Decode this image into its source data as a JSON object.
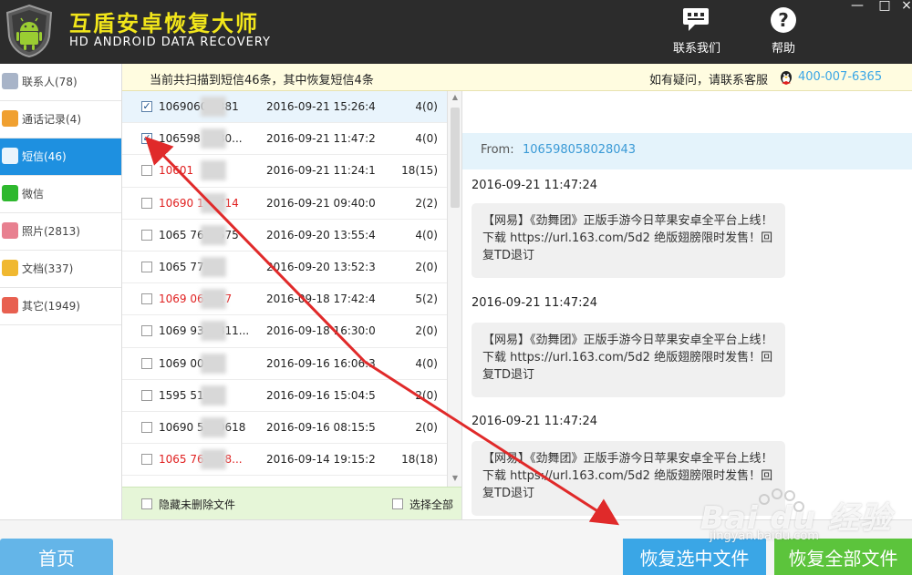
{
  "header": {
    "title": "互盾安卓恢复大师",
    "subtitle": "HD ANDROID DATA RECOVERY",
    "contact_label": "联系我们",
    "help_label": "帮助",
    "contact_icon": "chat-icon",
    "help_icon": "help-icon"
  },
  "window_controls": {
    "minimize": "—",
    "maximize": "□",
    "close": "×"
  },
  "sidebar": {
    "items": [
      {
        "label": "联系人(78)",
        "icon": "contacts-icon",
        "color": "#a8b4c8"
      },
      {
        "label": "通话记录(4)",
        "icon": "phone-icon",
        "color": "#f0a030"
      },
      {
        "label": "短信(46)",
        "icon": "message-icon",
        "color": "#ffffff"
      },
      {
        "label": "微信",
        "icon": "wechat-icon",
        "color": "#2eb82e"
      },
      {
        "label": "照片(2813)",
        "icon": "photo-icon",
        "color": "#e88090"
      },
      {
        "label": "文档(337)",
        "icon": "document-icon",
        "color": "#f0b830"
      },
      {
        "label": "其它(1949)",
        "icon": "other-icon",
        "color": "#e86050"
      }
    ],
    "active_index": 2
  },
  "infobar": {
    "scan_text": "当前共扫描到短信46条，其中恢复短信4条",
    "contact_text": "如有疑问，请联系客服",
    "phone": "400-007-6365"
  },
  "message_list": {
    "rows": [
      {
        "number": "1069060    5381",
        "date": "2016-09-21 15:26:4",
        "count": "4(0)",
        "checked": true,
        "red": false
      },
      {
        "number": "106598     0280...",
        "date": "2016-09-21 11:47:2",
        "count": "4(0)",
        "checked": true,
        "red": false
      },
      {
        "number": "10601",
        "date": "2016-09-21 11:24:1",
        "count": "18(15)",
        "checked": false,
        "red": true
      },
      {
        "number": "10690     135714",
        "date": "2016-09-21 09:40:0",
        "count": "2(2)",
        "checked": false,
        "red": true
      },
      {
        "number": "1065     7696575",
        "date": "2016-09-20 13:55:4",
        "count": "4(0)",
        "checked": false,
        "red": false
      },
      {
        "number": "1065     771",
        "date": "2016-09-20 13:52:3",
        "count": "2(0)",
        "checked": false,
        "red": false
      },
      {
        "number": "1069     060717",
        "date": "2016-09-18 17:42:4",
        "count": "5(2)",
        "checked": false,
        "red": true
      },
      {
        "number": "1069     9348811...",
        "date": "2016-09-18 16:30:0",
        "count": "2(0)",
        "checked": false,
        "red": false
      },
      {
        "number": "1069     0069",
        "date": "2016-09-16 16:06:3",
        "count": "4(0)",
        "checked": false,
        "red": false
      },
      {
        "number": "1595     5106",
        "date": "2016-09-16 15:04:5",
        "count": "2(0)",
        "checked": false,
        "red": false
      },
      {
        "number": "10690     5400618",
        "date": "2016-09-16 08:15:5",
        "count": "2(0)",
        "checked": false,
        "red": false
      },
      {
        "number": "1065     766618...",
        "date": "2016-09-14 19:15:2",
        "count": "18(18)",
        "checked": false,
        "red": true
      }
    ]
  },
  "list_footer": {
    "hide_undeleted": "隐藏未删除文件",
    "select_all": "选择全部"
  },
  "conversation": {
    "from_label": "From:",
    "from_number": "106598058028043",
    "messages": [
      {
        "time": "2016-09-21 11:47:24",
        "text": "【网易】《劲舞团》正版手游今日苹果安卓全平台上线！下载 https://url.163.com/5d2 绝版翅膀限时发售！回复TD退订"
      },
      {
        "time": "2016-09-21 11:47:24",
        "text": "【网易】《劲舞团》正版手游今日苹果安卓全平台上线！下载 https://url.163.com/5d2 绝版翅膀限时发售！回复TD退订"
      },
      {
        "time": "2016-09-21 11:47:24",
        "text": "【网易】《劲舞团》正版手游今日苹果安卓全平台上线！下载 https://url.163.com/5d2 绝版翅膀限时发售！回复TD退订"
      }
    ]
  },
  "bottom": {
    "home": "首页",
    "recover_selected": "恢复选中文件",
    "recover_all": "恢复全部文件"
  },
  "watermark": {
    "brand": "Bai du 经验",
    "url": "jingyan.baidu.com"
  },
  "colors": {
    "accent_blue": "#1e90e0",
    "title_yellow": "#f2e61a",
    "annotation_red": "#e02a2a",
    "recover_green": "#5cc43c"
  }
}
